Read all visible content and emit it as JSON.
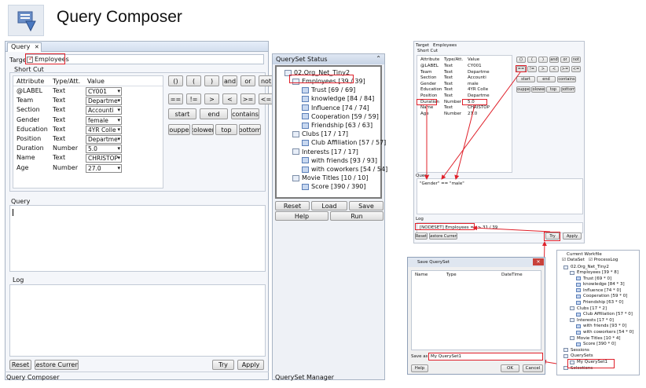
{
  "header": {
    "title": "Query Composer"
  },
  "main": {
    "tab_query": "Query",
    "target_label": "Target",
    "target_value": "Employees",
    "shortcut_label": "Short Cut",
    "table_headers": [
      "Attribute",
      "Type/Att.",
      "Value"
    ],
    "rows": [
      {
        "attr": "@LABEL",
        "type": "Text",
        "value": "CY001"
      },
      {
        "attr": "Team",
        "type": "Text",
        "value": "Departme"
      },
      {
        "attr": "Section",
        "type": "Text",
        "value": "Accounti"
      },
      {
        "attr": "Gender",
        "type": "Text",
        "value": "female"
      },
      {
        "attr": "Education",
        "type": "Text",
        "value": "4YR Colle"
      },
      {
        "attr": "Position",
        "type": "Text",
        "value": "Departme"
      },
      {
        "attr": "Duration",
        "type": "Number",
        "value": "5.0"
      },
      {
        "attr": "Name",
        "type": "Text",
        "value": "CHRISTOP"
      },
      {
        "attr": "Age",
        "type": "Number",
        "value": "27.0"
      }
    ],
    "op_row1": [
      "()",
      "(",
      ")",
      "and",
      "or",
      "not"
    ],
    "op_row2": [
      "==",
      "!=",
      ">",
      "<",
      ">=",
      "<="
    ],
    "op_row3": [
      "start",
      "end",
      "contains"
    ],
    "op_row4": [
      "toupper",
      "tolower",
      "top",
      "bottom"
    ],
    "query_label": "Query",
    "log_label": "Log",
    "reset": "Reset",
    "restore": "Restore Current",
    "try": "Try",
    "apply": "Apply",
    "footer_left": "Query Composer",
    "footer_right": "QuerySet Manager"
  },
  "qs": {
    "title": "QuerySet Status",
    "root": "02.Org_Net_Tiny2",
    "items": [
      {
        "label": "Employees [39 / 39]",
        "level": 1
      },
      {
        "label": "Trust [69 / 69]",
        "level": 2
      },
      {
        "label": "knowledge [84 / 84]",
        "level": 2
      },
      {
        "label": "Influence [74 / 74]",
        "level": 2
      },
      {
        "label": "Cooperation [59 / 59]",
        "level": 2
      },
      {
        "label": "Friendship [63 / 63]",
        "level": 2
      },
      {
        "label": "Clubs [17 / 17]",
        "level": 1
      },
      {
        "label": "Club Affiliation [57 / 57]",
        "level": 2
      },
      {
        "label": "Interests [17 / 17]",
        "level": 1
      },
      {
        "label": "with friends [93 / 93]",
        "level": 2
      },
      {
        "label": "with coworkers [54 / 54]",
        "level": 2
      },
      {
        "label": "Movie Titles [10 / 10]",
        "level": 1
      },
      {
        "label": "Score [390 / 390]",
        "level": 2
      }
    ],
    "reset": "Reset",
    "load": "Load",
    "save": "Save",
    "help": "Help",
    "run": "Run"
  },
  "small": {
    "target_label": "Target",
    "target_value": "Employees",
    "shortcut_label": "Short Cut",
    "headers": [
      "Attribute",
      "Type/Att.",
      "Value"
    ],
    "rows": [
      {
        "attr": "@LABEL",
        "type": "Text",
        "value": "CY001"
      },
      {
        "attr": "Team",
        "type": "Text",
        "value": "Departme"
      },
      {
        "attr": "Section",
        "type": "Text",
        "value": "Accounti"
      },
      {
        "attr": "Gender",
        "type": "Text",
        "value": "male"
      },
      {
        "attr": "Education",
        "type": "Text",
        "value": "4YR Colle"
      },
      {
        "attr": "Position",
        "type": "Text",
        "value": "Departme"
      },
      {
        "attr": "Duration",
        "type": "Number",
        "value": "5.0"
      },
      {
        "attr": "Name",
        "type": "Text",
        "value": "CHRISTOP"
      },
      {
        "attr": "Age",
        "type": "Number",
        "value": "27.0"
      }
    ],
    "ops1": [
      "()",
      "(",
      ")",
      "and",
      "or",
      "not"
    ],
    "ops2": [
      "==",
      "!=",
      ">",
      "<",
      ">=",
      "<="
    ],
    "ops3": [
      "start",
      "end",
      "contains"
    ],
    "ops4": [
      "toupper",
      "tolower",
      "top",
      "bottom"
    ],
    "query_label": "Query",
    "query_text": "\"Gender\" == \"male\"",
    "log_label": "Log",
    "log_text": "[NODESET] Employees ==> 31 / 39",
    "reset": "Reset",
    "restore": "Restore Current",
    "try": "Try",
    "apply": "Apply"
  },
  "save_dialog": {
    "title": "Save QuerySet",
    "cols": [
      "Name",
      "Type",
      "DateTime"
    ],
    "save_as_label": "Save as",
    "save_as_value": "My QuerySet1",
    "help": "Help",
    "ok": "OK",
    "cancel": "Cancel"
  },
  "workfile": {
    "title": "Current Workfile",
    "dataset": "DataSet",
    "processlog": "ProcessLog",
    "root": "02.Org_Net_Tiny2",
    "items": [
      {
        "label": "Employees [39 * 8]",
        "level": 1
      },
      {
        "label": "Trust [69 * 0]",
        "level": 2
      },
      {
        "label": "knowledge [84 * 3]",
        "level": 2
      },
      {
        "label": "Influence [74 * 0]",
        "level": 2
      },
      {
        "label": "Cooperation [59 * 0]",
        "level": 2
      },
      {
        "label": "Friendship [63 * 0]",
        "level": 2
      },
      {
        "label": "Clubs [17 * 2]",
        "level": 1
      },
      {
        "label": "Club Affiliation [57 * 0]",
        "level": 2
      },
      {
        "label": "Interests [17 * 0]",
        "level": 1
      },
      {
        "label": "with friends [93 * 0]",
        "level": 2
      },
      {
        "label": "with coworkers [54 * 0]",
        "level": 2
      },
      {
        "label": "Movie Titles [10 * 4]",
        "level": 1
      },
      {
        "label": "Score [390 * 0]",
        "level": 2
      },
      {
        "label": "Sessions",
        "level": 0
      },
      {
        "label": "QuerySets",
        "level": 0
      },
      {
        "label": "My QuerySet1",
        "level": 1
      },
      {
        "label": "Selections",
        "level": 0
      }
    ]
  }
}
